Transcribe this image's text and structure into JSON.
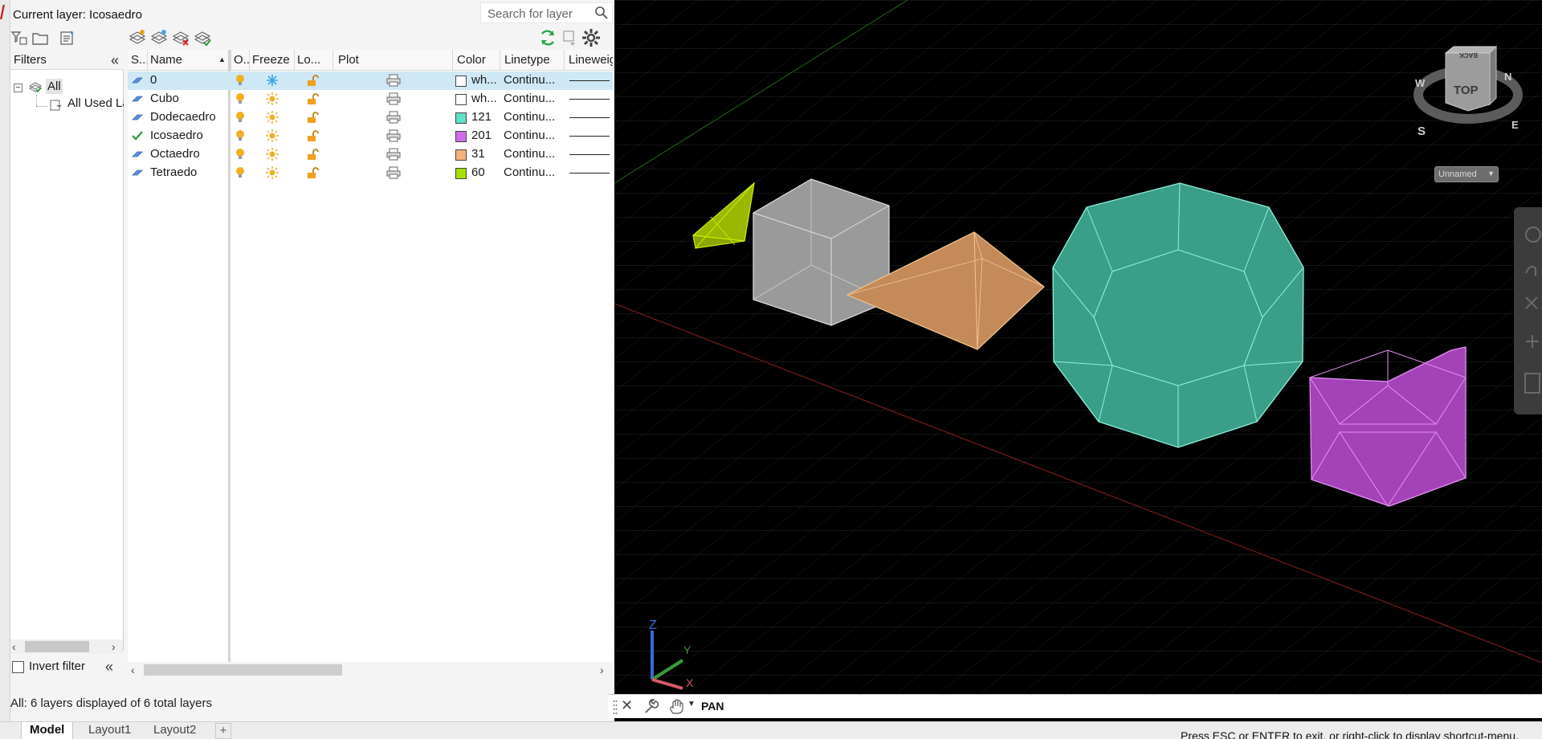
{
  "panel": {
    "current_layer": "Current layer: Icosaedro",
    "search_placeholder": "Search for layer"
  },
  "filters": {
    "header": "Filters",
    "tree_all": "All",
    "tree_used": "All Used La",
    "invert_label": "Invert filter"
  },
  "table": {
    "columns": [
      "S...",
      "Name",
      "O...",
      "Freeze",
      "Lo...",
      "Plot",
      "Color",
      "Linetype",
      "Lineweig"
    ],
    "rows": [
      {
        "name": "0",
        "color_label": "wh...",
        "color": "#ffffff",
        "linetype": "Continu...",
        "current": false,
        "selected": true
      },
      {
        "name": "Cubo",
        "color_label": "wh...",
        "color": "#ffffff",
        "linetype": "Continu...",
        "current": false,
        "selected": false
      },
      {
        "name": "Dodecaedro",
        "color_label": "121",
        "color": "#5fe0c8",
        "linetype": "Continu...",
        "current": false,
        "selected": false
      },
      {
        "name": "Icosaedro",
        "color_label": "201",
        "color": "#cf6ee8",
        "linetype": "Continu...",
        "current": true,
        "selected": false
      },
      {
        "name": "Octaedro",
        "color_label": "31",
        "color": "#f5b27a",
        "linetype": "Continu...",
        "current": false,
        "selected": false
      },
      {
        "name": "Tetraedo",
        "color_label": "60",
        "color": "#a6e000",
        "linetype": "Continu...",
        "current": false,
        "selected": false
      }
    ]
  },
  "status": {
    "layers_summary": "All: 6 layers displayed of 6 total layers",
    "hint": "Press ESC or ENTER to exit, or right-click to display shortcut-menu."
  },
  "command": {
    "text": "PAN"
  },
  "tabs": [
    "Model",
    "Layout1",
    "Layout2"
  ],
  "viewcube": {
    "face": "TOP",
    "back": "BACK",
    "compass": [
      "N",
      "E",
      "S",
      "W"
    ],
    "ucs_named": "Unnamed"
  },
  "ucs": {
    "z": "Z",
    "y": "Y",
    "x": "X"
  },
  "colors": {
    "tetra": "#a6c800",
    "cube": "#b0b0b0",
    "octa": "#d9a06a",
    "dodeca": "#3ea890",
    "icosa": "#b040c8"
  }
}
